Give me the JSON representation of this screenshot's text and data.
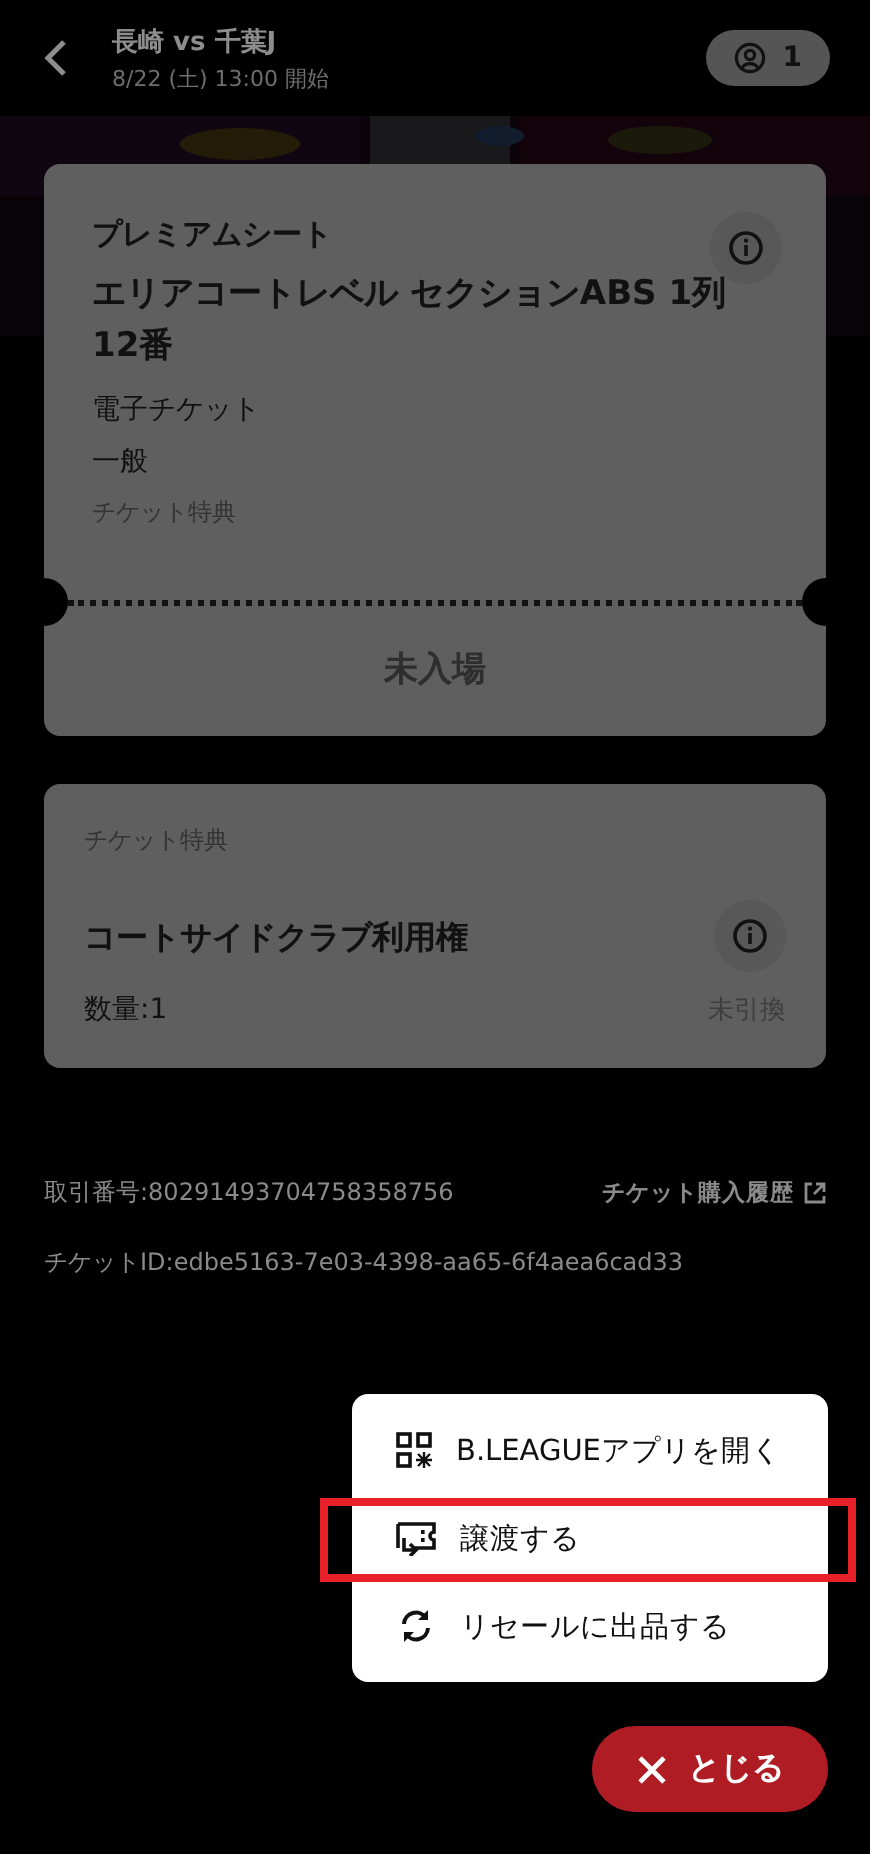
{
  "header": {
    "title": "長崎 vs 千葉J",
    "subtitle": "8/22 (土) 13:00 開始",
    "count": "1"
  },
  "ticket": {
    "seat_type": "プレミアムシート",
    "seat": "エリアコートレベル セクションABS 1列 12番",
    "format": "電子チケット",
    "category": "一般",
    "perk_label": "チケット特典",
    "status": "未入場"
  },
  "perk": {
    "label": "チケット特典",
    "name": "コートサイドクラブ利用権",
    "quantity": "数量:1",
    "status": "未引換"
  },
  "transaction": {
    "number": "取引番号:80291493704758358756",
    "history_link": "チケット購入履歴",
    "ticket_id": "チケットID:edbe5163-7e03-4398-aa65-6f4aea6cad33"
  },
  "menu": {
    "items": [
      {
        "label": "B.LEAGUEアプリを開く",
        "selected": false
      },
      {
        "label": "譲渡する",
        "selected": true
      },
      {
        "label": "リセールに出品する",
        "selected": false
      }
    ]
  },
  "close_button": {
    "label": "とじる"
  }
}
